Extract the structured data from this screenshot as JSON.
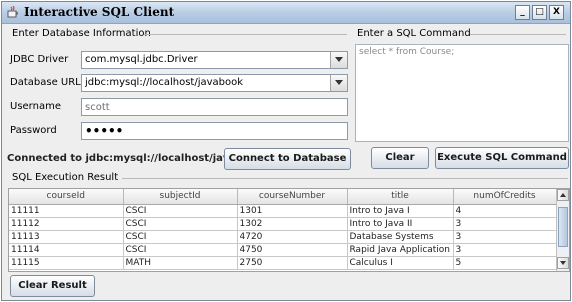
{
  "window": {
    "title": "Interactive SQL Client",
    "controls": [
      "_",
      "□",
      "X"
    ]
  },
  "db_info": {
    "section_title": "Enter Database Information",
    "jdbc_driver_label": "JDBC Driver",
    "jdbc_driver_value": "com.mysql.jdbc.Driver",
    "db_url_label": "Database URL",
    "db_url_value": "jdbc:mysql://localhost/javabook",
    "username_label": "Username",
    "username_value": "scott",
    "password_label": "Password",
    "password_value": "•••••"
  },
  "sql": {
    "section_title": "Enter a SQL Command",
    "command_text": "select * from Course;"
  },
  "status": {
    "connection_text": "Connected to jdbc:mysql://localhost/javabook",
    "connect_button": "Connect to Database",
    "clear_button": "Clear",
    "execute_button": "Execute SQL Command"
  },
  "result": {
    "section_title": "SQL Execution Result",
    "columns": [
      "courseId",
      "subjectId",
      "courseNumber",
      "title",
      "numOfCredits"
    ],
    "rows": [
      [
        "11111",
        "CSCI",
        "1301",
        "Intro to Java I",
        "4"
      ],
      [
        "11112",
        "CSCI",
        "1302",
        "Intro to Java II",
        "3"
      ],
      [
        "11113",
        "CSCI",
        "4720",
        "Database Systems",
        "3"
      ],
      [
        "11114",
        "CSCI",
        "4750",
        "Rapid Java Application",
        "3"
      ],
      [
        "11115",
        "MATH",
        "2750",
        "Calculus I",
        "5"
      ]
    ],
    "clear_result_button": "Clear Result"
  }
}
